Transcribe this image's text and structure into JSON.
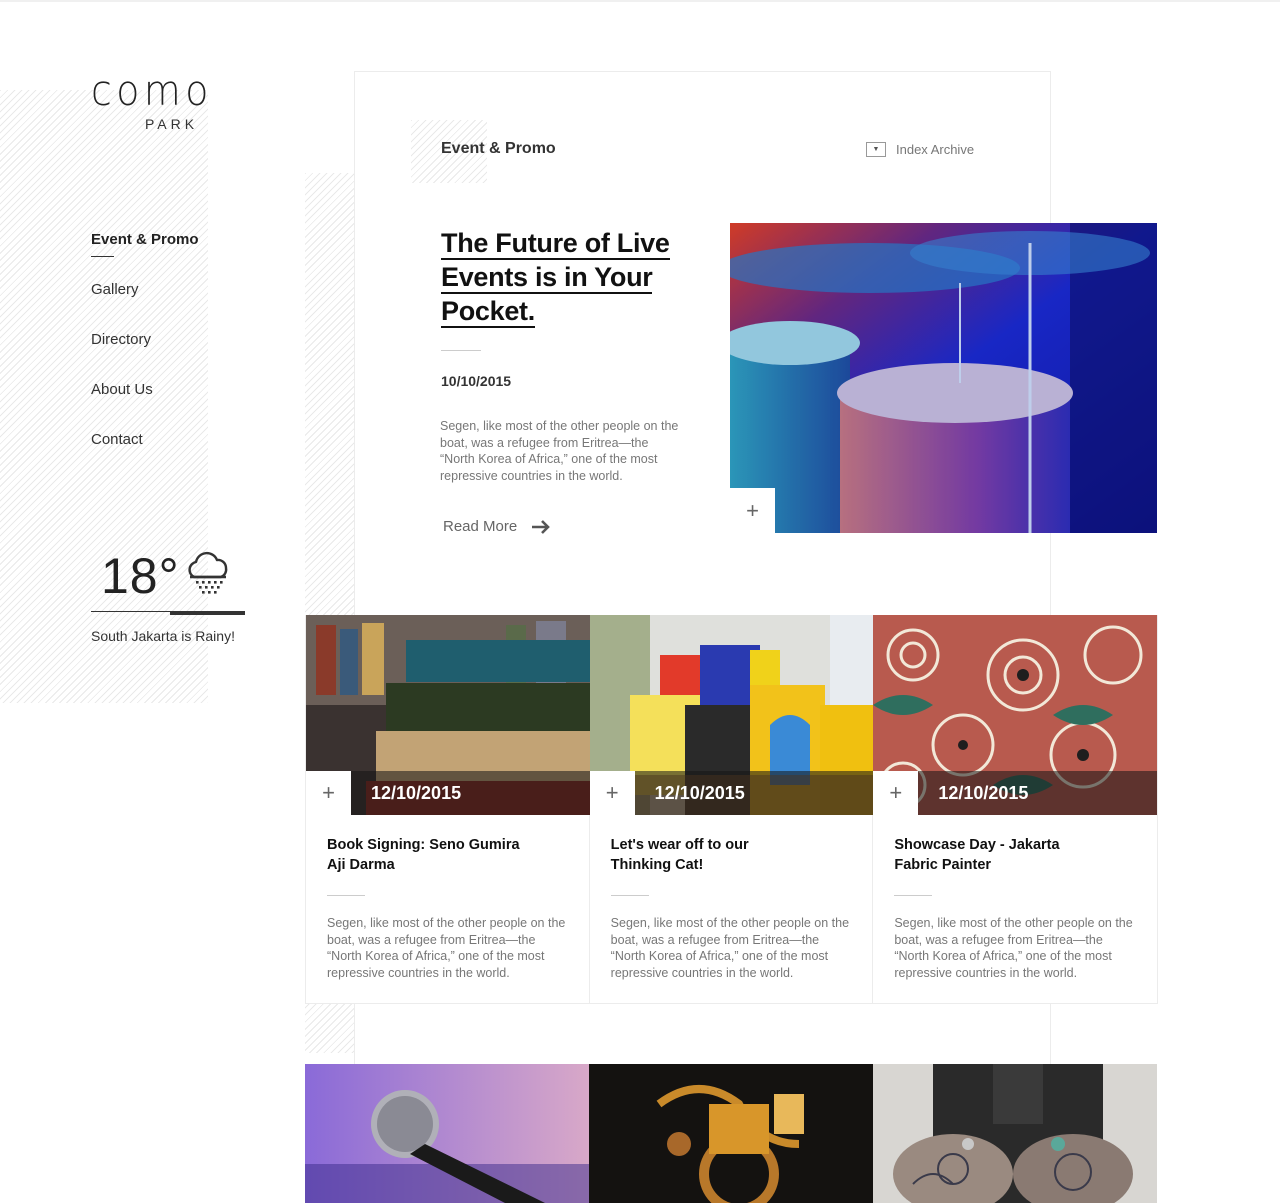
{
  "logo": {
    "main": "como",
    "sub": "PARK"
  },
  "nav": {
    "items": [
      {
        "label": "Event & Promo"
      },
      {
        "label": "Gallery"
      },
      {
        "label": "Directory"
      },
      {
        "label": "About Us"
      },
      {
        "label": "Contact"
      }
    ]
  },
  "weather": {
    "temperature": "18°",
    "caption": "South Jakarta is Rainy!",
    "icon": "rain-cloud-icon"
  },
  "section": {
    "title": "Event & Promo",
    "archive_label": "Index Archive"
  },
  "feature": {
    "title": "The Future of Live Events is in Your Pocket.",
    "date": "10/10/2015",
    "excerpt": "Segen, like most of the other people on the boat, was a refugee from Eritrea—the “North Korea of Africa,” one of the most repressive countries in the world.",
    "read_more": "Read More",
    "image": "drum-kit-photo"
  },
  "cards": [
    {
      "date": "12/10/2015",
      "title": "Book Signing: Seno Gumira Aji Darma",
      "excerpt": "Segen, like most of the other people on the boat, was a refugee from Eritrea—the “North Korea of Africa,” one of the most repressive countries in the world.",
      "image": "books-photo"
    },
    {
      "date": "12/10/2015",
      "title": "Let's wear off to our Thinking Cat!",
      "excerpt": "Segen, like most of the other people on the boat, was a refugee from Eritrea—the “North Korea of Africa,” one of the most repressive countries in the world.",
      "image": "cat-paintings-photo"
    },
    {
      "date": "12/10/2015",
      "title": "Showcase Day - Jakarta Fabric Painter",
      "excerpt": "Segen, like most of the other people on the boat, was a refugee from Eritrea—the “North Korea of Africa,” one of the most repressive countries in the world.",
      "image": "batik-fabric-photo"
    }
  ],
  "bottom_images": [
    "microphone-photo",
    "motorcycle-sculpture-photo",
    "tattooed-hands-photo"
  ],
  "colors": {
    "text": "#222222",
    "muted": "#777777",
    "border": "#ececec"
  }
}
